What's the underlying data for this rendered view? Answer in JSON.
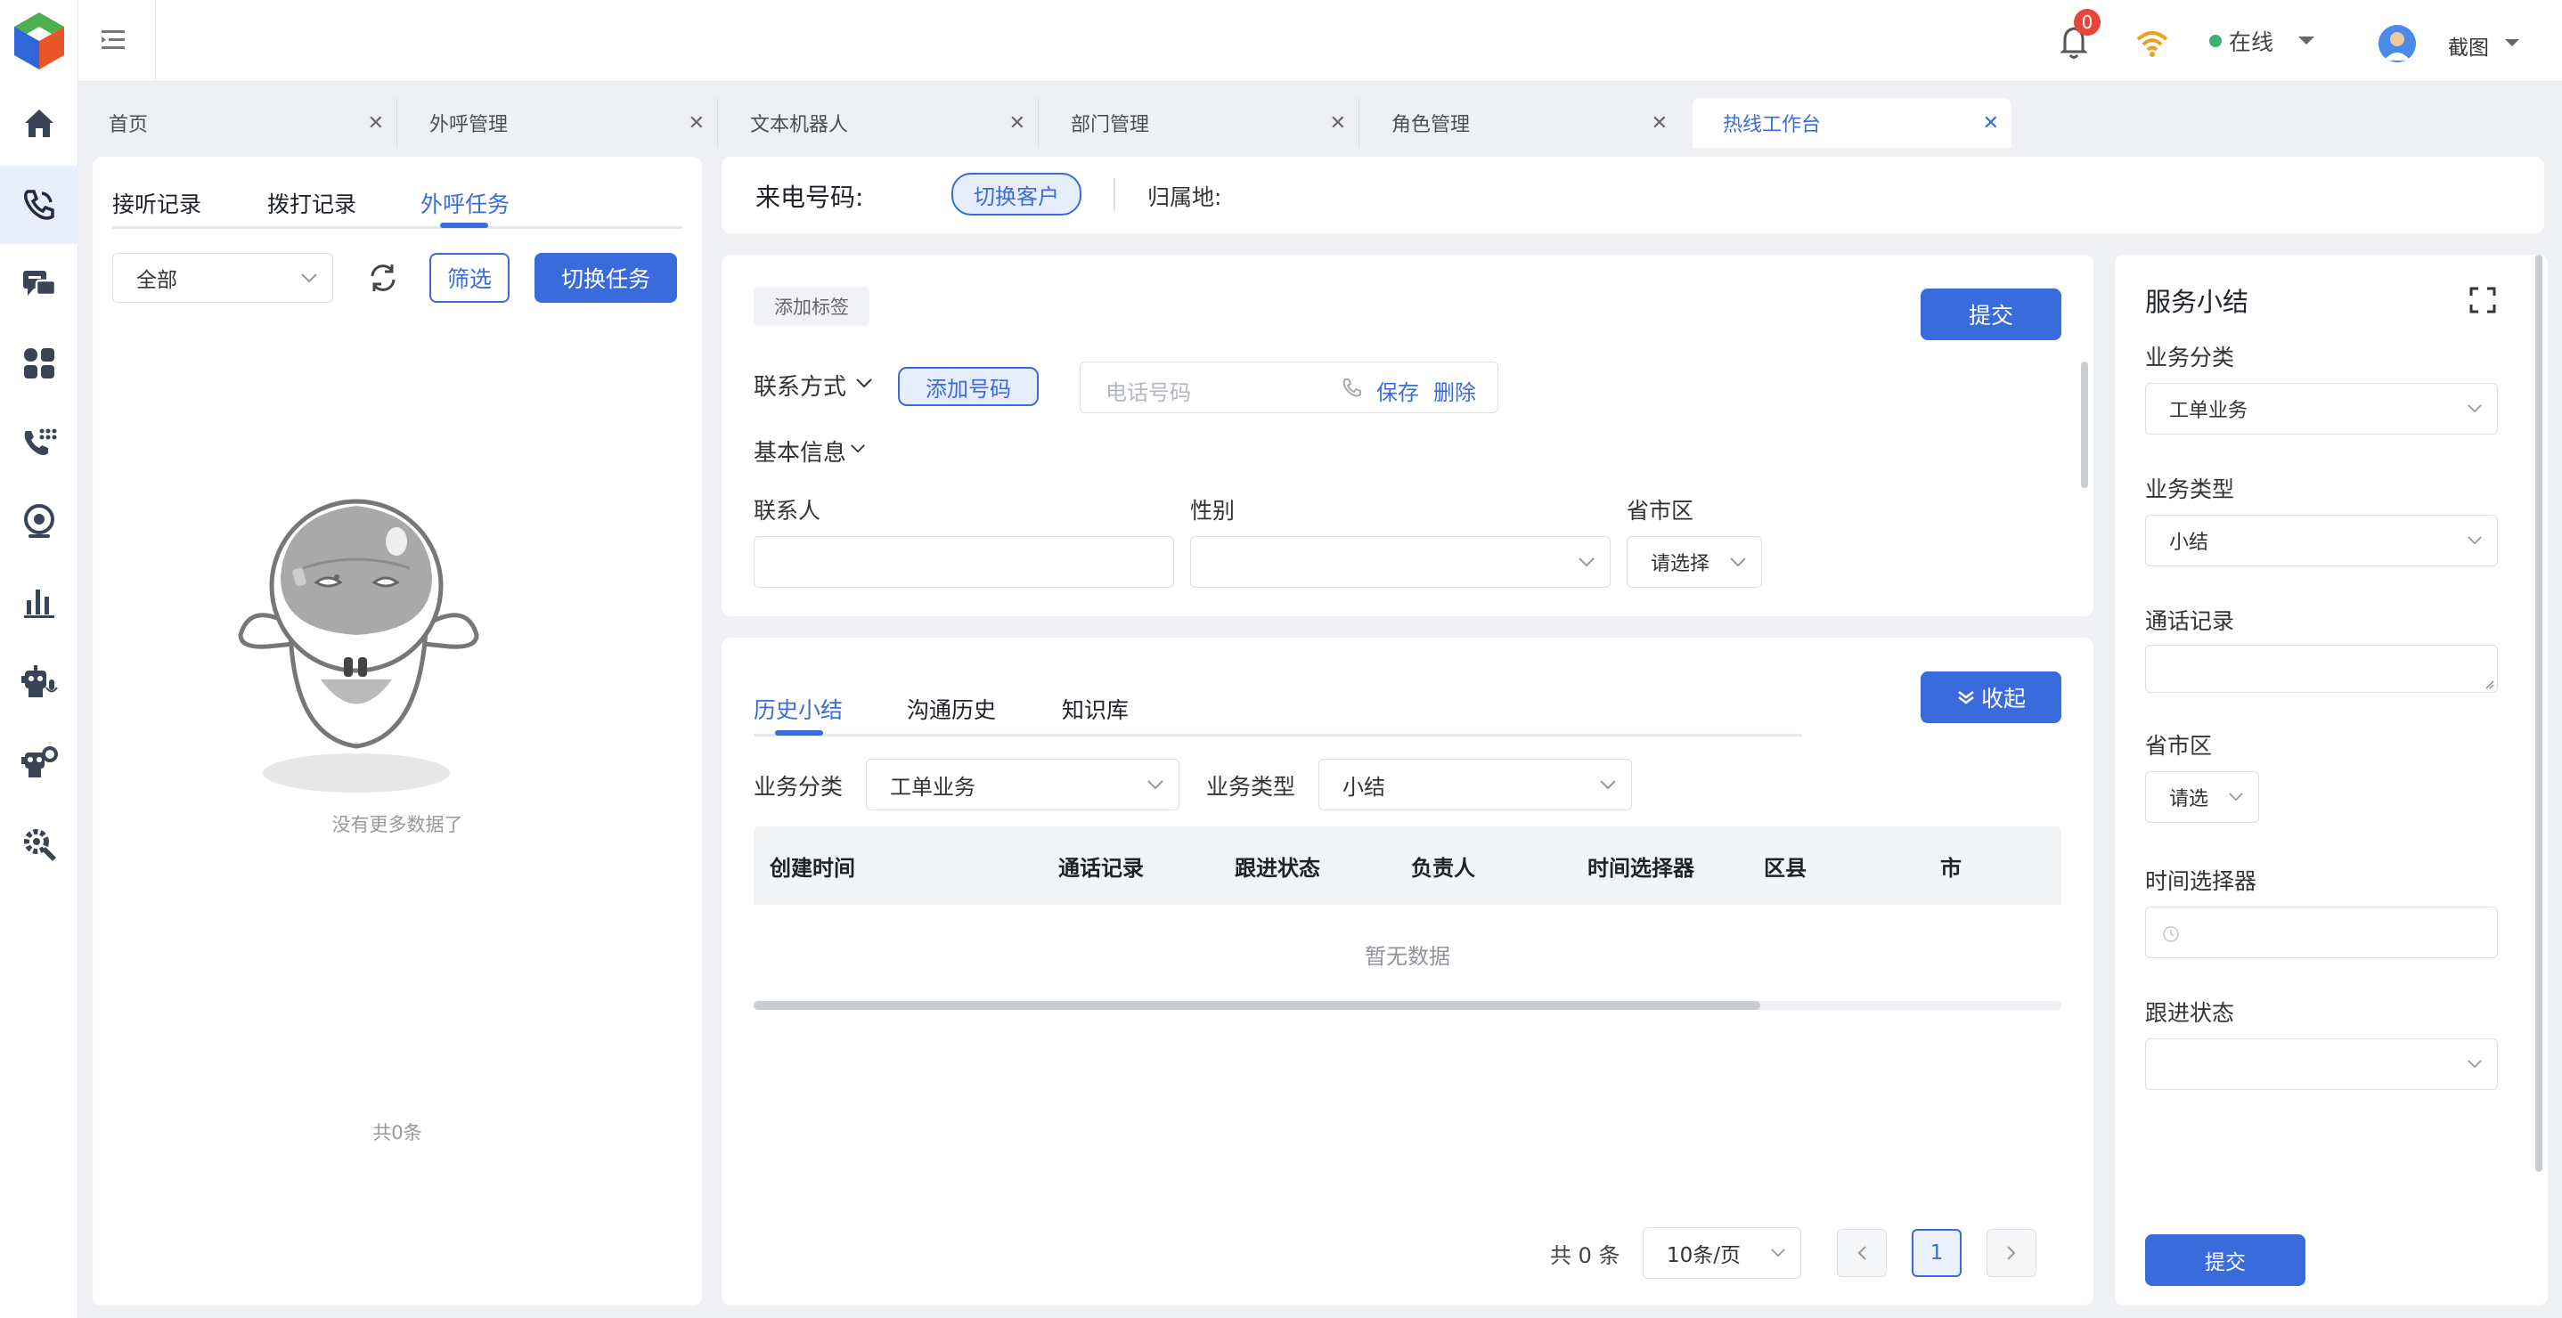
{
  "header": {
    "notification_count": "0",
    "status": "在线",
    "username": "截图"
  },
  "tabs": [
    {
      "label": "首页"
    },
    {
      "label": "外呼管理"
    },
    {
      "label": "文本机器人"
    },
    {
      "label": "部门管理"
    },
    {
      "label": "角色管理"
    },
    {
      "label": "热线工作台"
    }
  ],
  "left": {
    "subtabs": [
      "接听记录",
      "拨打记录",
      "外呼任务"
    ],
    "filter_select": "全部",
    "filter_btn": "筛选",
    "switch_task_btn": "切换任务",
    "empty_text": "没有更多数据了",
    "total": "共0条"
  },
  "caller": {
    "label": "来电号码:",
    "switch_btn": "切换客户",
    "location_label": "归属地:"
  },
  "form": {
    "add_tag": "添加标签",
    "submit": "提交",
    "contact_method": "联系方式",
    "add_number": "添加号码",
    "phone_placeholder": "电话号码",
    "save": "保存",
    "delete": "删除",
    "basic_info": "基本信息",
    "contact_person": "联系人",
    "gender": "性别",
    "province": "省市区",
    "province_placeholder": "请选择"
  },
  "history": {
    "tabs": [
      "历史小结",
      "沟通历史",
      "知识库"
    ],
    "collapse_btn": "收起",
    "biz_category_label": "业务分类",
    "biz_category_value": "工单业务",
    "biz_type_label": "业务类型",
    "biz_type_value": "小结",
    "columns": [
      "创建时间",
      "通话记录",
      "跟进状态",
      "负责人",
      "时间选择器",
      "区县",
      "市"
    ],
    "empty": "暂无数据",
    "total": "共 0 条",
    "page_size": "10条/页",
    "page": "1"
  },
  "summary": {
    "title": "服务小结",
    "biz_category_label": "业务分类",
    "biz_category_value": "工单业务",
    "biz_type_label": "业务类型",
    "biz_type_value": "小结",
    "call_record_label": "通话记录",
    "province_label": "省市区",
    "province_placeholder": "请选",
    "time_picker_label": "时间选择器",
    "follow_status_label": "跟进状态",
    "submit": "提交"
  },
  "colors": {
    "primary": "#3a6bdc",
    "online": "#3cb371",
    "badge": "#e8453c"
  }
}
